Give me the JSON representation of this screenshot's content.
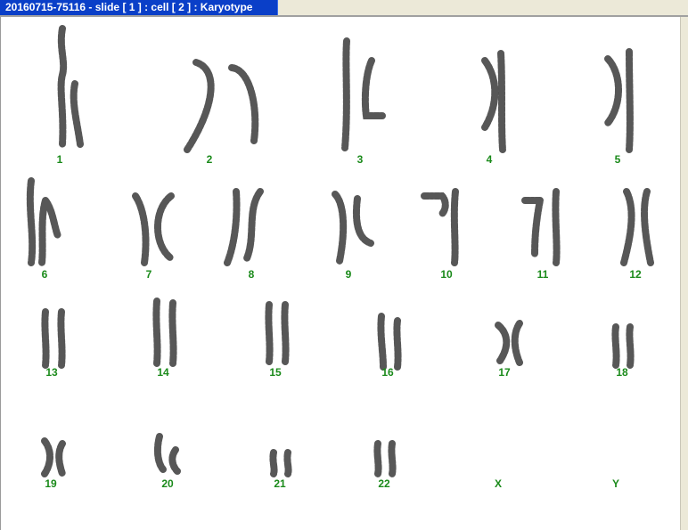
{
  "window": {
    "title": "20160715-75116 - slide [ 1 ] : cell [ 2 ] : Karyotype"
  },
  "colors": {
    "title_bg": "#0a3fc8",
    "label_green": "#1a8a1a",
    "chromosome": "#3a3a3a"
  },
  "chromosomes": [
    {
      "label": "1"
    },
    {
      "label": "2"
    },
    {
      "label": "3"
    },
    {
      "label": "4"
    },
    {
      "label": "5"
    },
    {
      "label": "6"
    },
    {
      "label": "7"
    },
    {
      "label": "8"
    },
    {
      "label": "9"
    },
    {
      "label": "10"
    },
    {
      "label": "11"
    },
    {
      "label": "12"
    },
    {
      "label": "13"
    },
    {
      "label": "14"
    },
    {
      "label": "15"
    },
    {
      "label": "16"
    },
    {
      "label": "17"
    },
    {
      "label": "18"
    },
    {
      "label": "19"
    },
    {
      "label": "20"
    },
    {
      "label": "21"
    },
    {
      "label": "22"
    },
    {
      "label": "X"
    },
    {
      "label": "Y"
    }
  ]
}
